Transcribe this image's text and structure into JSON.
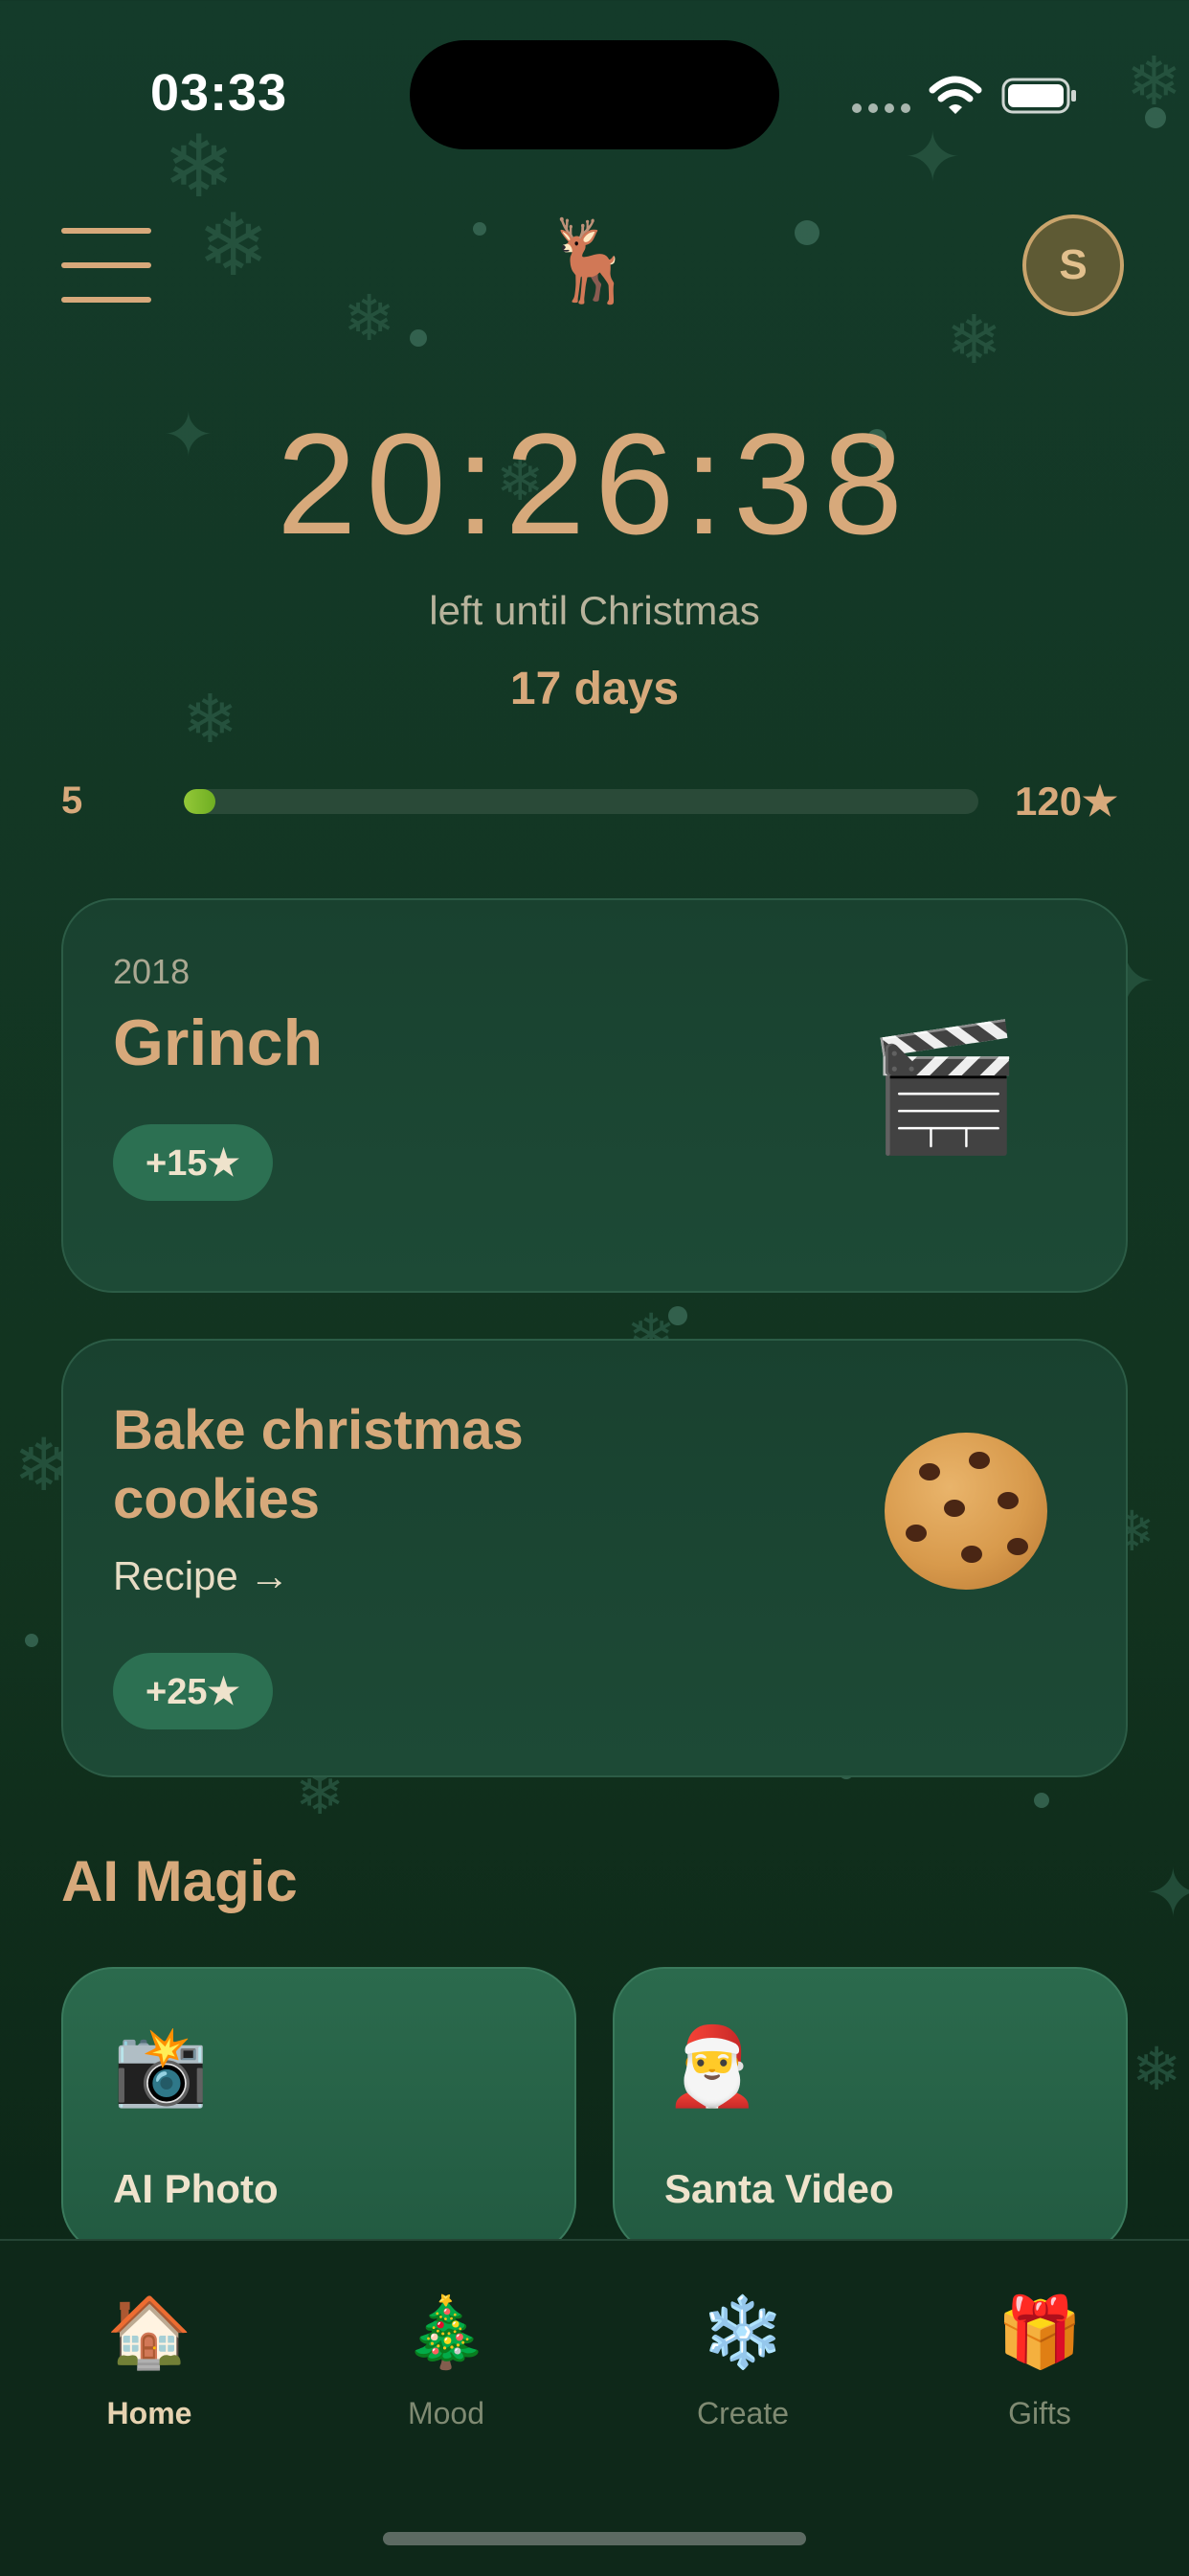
{
  "status_bar": {
    "time": "03:33",
    "icons": [
      "signal-dots-icon",
      "wifi-icon",
      "battery-icon"
    ]
  },
  "header": {
    "menu_icon": "hamburger-menu-icon",
    "logo_emoji": "🦌",
    "avatar_initial": "S"
  },
  "countdown": {
    "time": "20:26:38",
    "label": "left until Christmas",
    "days": "17 days"
  },
  "progress": {
    "min": "5",
    "max": "120★",
    "fraction": 0.04
  },
  "cards": [
    {
      "year": "2018",
      "title": "Grinch",
      "reward": "+15★",
      "icon": "clapperboard-icon",
      "emoji": "🎬"
    },
    {
      "title": "Bake christmas cookies",
      "link": "Recipe →",
      "reward": "+25★",
      "icon": "cookie-icon"
    }
  ],
  "ai_magic": {
    "title": "AI Magic",
    "items": [
      {
        "label": "AI Photo",
        "emoji": "📸",
        "icon": "camera-flash-icon"
      },
      {
        "label": "Santa Video",
        "emoji": "🎅",
        "icon": "santa-icon"
      }
    ]
  },
  "tab_bar": {
    "tabs": [
      {
        "label": "Home",
        "emoji": "🏠",
        "icon": "house-icon",
        "active": true
      },
      {
        "label": "Mood",
        "emoji": "🎄",
        "icon": "christmas-tree-icon",
        "active": false
      },
      {
        "label": "Create",
        "emoji": "❄️",
        "icon": "snowflake-icon",
        "active": false
      },
      {
        "label": "Gifts",
        "emoji": "🎁",
        "icon": "gift-icon",
        "active": false
      }
    ]
  },
  "colors": {
    "background": "#143b2a",
    "accent": "#d7a97b",
    "progress_fill": "#93c838",
    "pill": "#2c7052"
  }
}
